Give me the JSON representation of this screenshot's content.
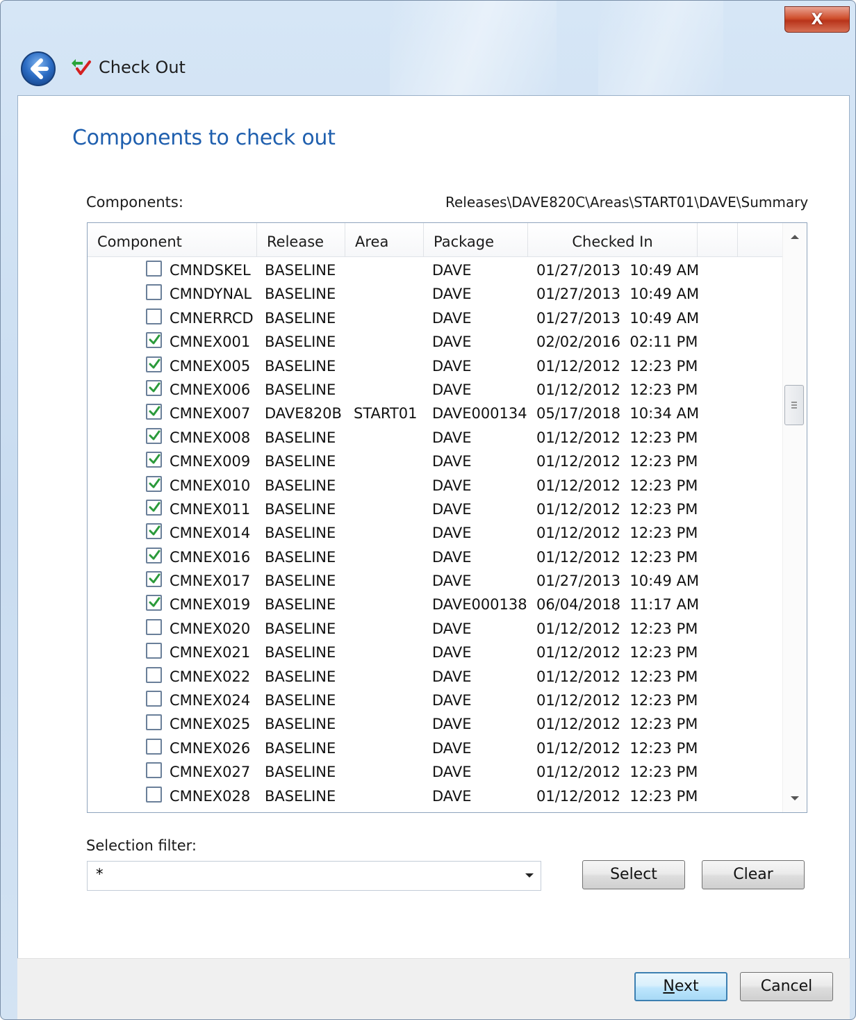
{
  "window": {
    "title": "Check Out",
    "close_symbol": "X",
    "back_icon": "back-arrow-icon",
    "title_icon": "check-out-icon"
  },
  "page": {
    "heading": "Components to check out",
    "components_label": "Components:",
    "path": "Releases\\DAVE820C\\Areas\\START01\\DAVE\\Summary"
  },
  "grid": {
    "columns": [
      "Component",
      "Release",
      "Area",
      "Package",
      "Checked In"
    ],
    "rows": [
      {
        "checked": false,
        "component": "CMNDSKEL",
        "release": "BASELINE",
        "area": "",
        "package": "DAVE",
        "checked_in": "01/27/2013  10:49 AM"
      },
      {
        "checked": false,
        "component": "CMNDYNAL",
        "release": "BASELINE",
        "area": "",
        "package": "DAVE",
        "checked_in": "01/27/2013  10:49 AM"
      },
      {
        "checked": false,
        "component": "CMNERRCD",
        "release": "BASELINE",
        "area": "",
        "package": "DAVE",
        "checked_in": "01/27/2013  10:49 AM"
      },
      {
        "checked": true,
        "component": "CMNEX001",
        "release": "BASELINE",
        "area": "",
        "package": "DAVE",
        "checked_in": "02/02/2016  02:11 PM"
      },
      {
        "checked": true,
        "component": "CMNEX005",
        "release": "BASELINE",
        "area": "",
        "package": "DAVE",
        "checked_in": "01/12/2012  12:23 PM"
      },
      {
        "checked": true,
        "component": "CMNEX006",
        "release": "BASELINE",
        "area": "",
        "package": "DAVE",
        "checked_in": "01/12/2012  12:23 PM"
      },
      {
        "checked": true,
        "component": "CMNEX007",
        "release": "DAVE820B",
        "area": "START01",
        "package": "DAVE000134",
        "checked_in": "05/17/2018  10:34 AM"
      },
      {
        "checked": true,
        "component": "CMNEX008",
        "release": "BASELINE",
        "area": "",
        "package": "DAVE",
        "checked_in": "01/12/2012  12:23 PM"
      },
      {
        "checked": true,
        "component": "CMNEX009",
        "release": "BASELINE",
        "area": "",
        "package": "DAVE",
        "checked_in": "01/12/2012  12:23 PM"
      },
      {
        "checked": true,
        "component": "CMNEX010",
        "release": "BASELINE",
        "area": "",
        "package": "DAVE",
        "checked_in": "01/12/2012  12:23 PM"
      },
      {
        "checked": true,
        "component": "CMNEX011",
        "release": "BASELINE",
        "area": "",
        "package": "DAVE",
        "checked_in": "01/12/2012  12:23 PM"
      },
      {
        "checked": true,
        "component": "CMNEX014",
        "release": "BASELINE",
        "area": "",
        "package": "DAVE",
        "checked_in": "01/12/2012  12:23 PM"
      },
      {
        "checked": true,
        "component": "CMNEX016",
        "release": "BASELINE",
        "area": "",
        "package": "DAVE",
        "checked_in": "01/12/2012  12:23 PM"
      },
      {
        "checked": true,
        "component": "CMNEX017",
        "release": "BASELINE",
        "area": "",
        "package": "DAVE",
        "checked_in": "01/27/2013  10:49 AM"
      },
      {
        "checked": true,
        "component": "CMNEX019",
        "release": "BASELINE",
        "area": "",
        "package": "DAVE000138",
        "checked_in": "06/04/2018  11:17 AM"
      },
      {
        "checked": false,
        "component": "CMNEX020",
        "release": "BASELINE",
        "area": "",
        "package": "DAVE",
        "checked_in": "01/12/2012  12:23 PM"
      },
      {
        "checked": false,
        "component": "CMNEX021",
        "release": "BASELINE",
        "area": "",
        "package": "DAVE",
        "checked_in": "01/12/2012  12:23 PM"
      },
      {
        "checked": false,
        "component": "CMNEX022",
        "release": "BASELINE",
        "area": "",
        "package": "DAVE",
        "checked_in": "01/12/2012  12:23 PM"
      },
      {
        "checked": false,
        "component": "CMNEX024",
        "release": "BASELINE",
        "area": "",
        "package": "DAVE",
        "checked_in": "01/12/2012  12:23 PM"
      },
      {
        "checked": false,
        "component": "CMNEX025",
        "release": "BASELINE",
        "area": "",
        "package": "DAVE",
        "checked_in": "01/12/2012  12:23 PM"
      },
      {
        "checked": false,
        "component": "CMNEX026",
        "release": "BASELINE",
        "area": "",
        "package": "DAVE",
        "checked_in": "01/12/2012  12:23 PM"
      },
      {
        "checked": false,
        "component": "CMNEX027",
        "release": "BASELINE",
        "area": "",
        "package": "DAVE",
        "checked_in": "01/12/2012  12:23 PM"
      },
      {
        "checked": false,
        "component": "CMNEX028",
        "release": "BASELINE",
        "area": "",
        "package": "DAVE",
        "checked_in": "01/12/2012  12:23 PM"
      }
    ]
  },
  "filter": {
    "label": "Selection filter:",
    "value": "*",
    "select_label": "Select",
    "clear_label": "Clear"
  },
  "footer": {
    "next_label_mnemonic": "N",
    "next_label_rest": "ext",
    "cancel_label": "Cancel"
  },
  "colors": {
    "heading": "#1f5fae",
    "checkmark": "#2a9a3a"
  }
}
